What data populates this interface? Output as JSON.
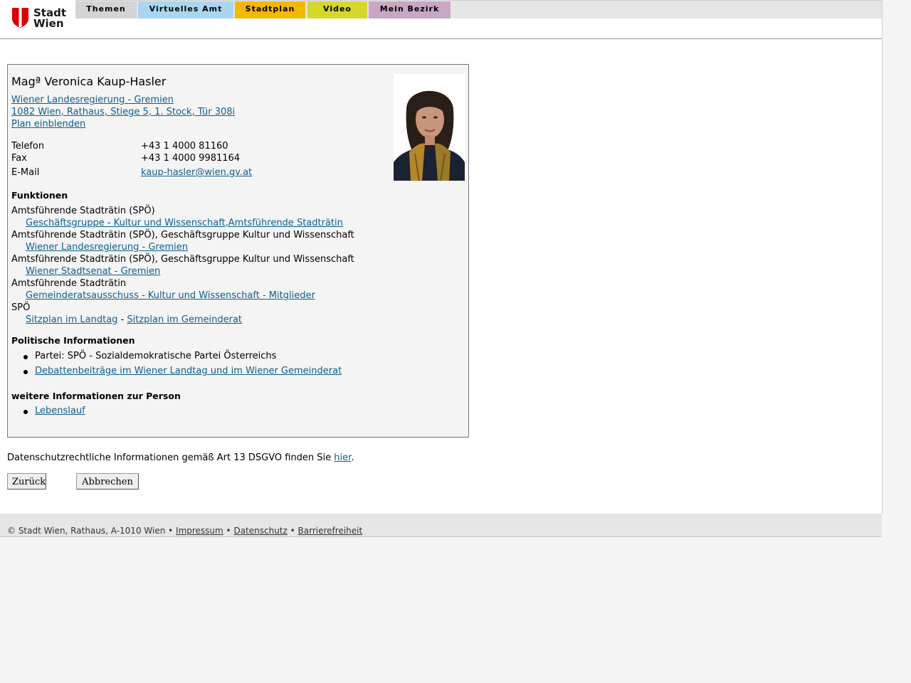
{
  "logo": {
    "line1": "Stadt",
    "line2": "Wien",
    "brand_color": "#dc0000"
  },
  "tabs": [
    {
      "label": "Themen",
      "color": "#d4d4d4"
    },
    {
      "label": "Virtuelles Amt",
      "color": "#a9d6f0"
    },
    {
      "label": "Stadtplan",
      "color": "#f5b800"
    },
    {
      "label": "Video",
      "color": "#d5d82c"
    },
    {
      "label": "Mein Bezirk",
      "color": "#c9a7c4"
    }
  ],
  "person": {
    "name": "Magª Veronica Kaup-Hasler",
    "org_link": "Wiener Landesregierung - Gremien ",
    "address_link": "1082 Wien, Rathaus, Stiege 5, 1. Stock, Tür 308i",
    "plan_link": "Plan einblenden"
  },
  "contact": [
    {
      "label": "Telefon",
      "value": "+43 1 4000 81160"
    },
    {
      "label": "Fax",
      "value": "+43 1 4000 9981164"
    },
    {
      "label": "E-Mail",
      "value": "kaup-hasler@wien.gv.at"
    }
  ],
  "functions": {
    "heading": "Funktionen",
    "items": [
      {
        "role": "Amtsführende Stadträtin (SPÖ)",
        "link": "Geschäftsgruppe - Kultur und Wissenschaft,Amtsführende Stadträtin"
      },
      {
        "role": "Amtsführende Stadträtin (SPÖ), Geschäftsgruppe Kultur und Wissenschaft",
        "link": "Wiener Landesregierung - Gremien"
      },
      {
        "role": "Amtsführende Stadträtin (SPÖ), Geschäftsgruppe Kultur und Wissenschaft",
        "link": "Wiener Stadtsenat - Gremien"
      },
      {
        "role": "Amtsführende Stadträtin",
        "link": "Gemeinderatsausschuss - Kultur und Wissenschaft - Mitglieder"
      }
    ],
    "party_role": "SPÖ",
    "seat_link_1": "Sitzplan im Landtag",
    "seat_sep": " - ",
    "seat_link_2": "Sitzplan im Gemeinderat"
  },
  "political": {
    "heading": "Politische Informationen",
    "party": "Partei: SPÖ - Sozialdemokratische Partei Österreichs",
    "debates_link": "Debattenbeiträge im Wiener Landtag und im Wiener Gemeinderat"
  },
  "more": {
    "heading": "weitere Informationen zur Person",
    "cv_link": "Lebenslauf"
  },
  "privacy": {
    "text": "Datenschutzrechtliche Informationen gemäß Art 13 DSGVO finden Sie ",
    "link": "hier",
    "end": "."
  },
  "buttons": {
    "back": "Zurück",
    "cancel": "Abbrechen"
  },
  "footer": {
    "copyright": "© Stadt Wien, Rathaus, A-1010 Wien",
    "sep": " • ",
    "impressum": "Impressum",
    "datenschutz": "Datenschutz",
    "barrierefreiheit": "Barrierefreiheit"
  }
}
